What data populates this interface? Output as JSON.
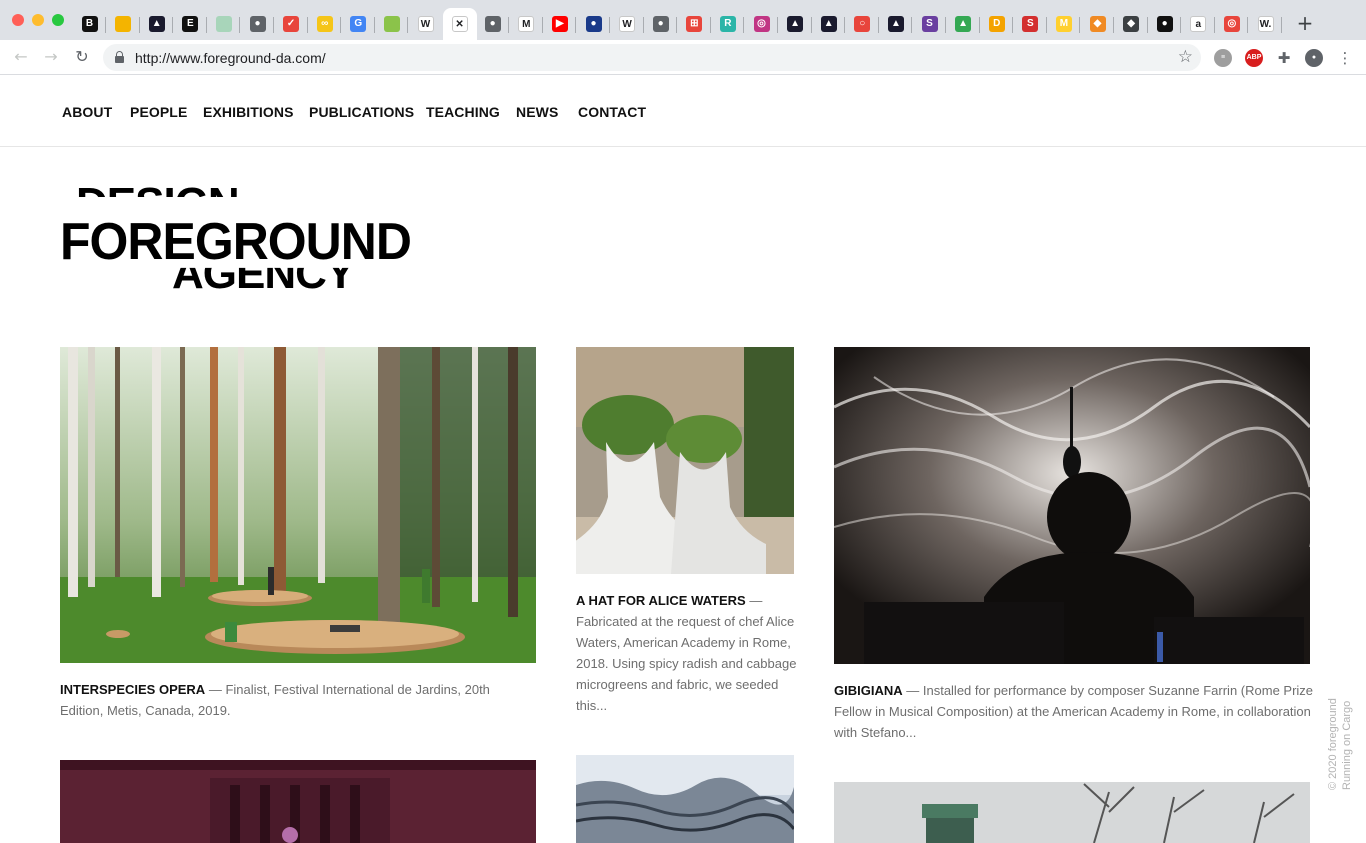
{
  "browser": {
    "url": "http://www.foreground-da.com/",
    "tab_favicons": [
      {
        "icon": "b-icon",
        "glyph": "B",
        "color": "#111111"
      },
      {
        "icon": "slides-icon",
        "glyph": "",
        "color": "#f4b400"
      },
      {
        "icon": "arch-icon",
        "glyph": "▲",
        "color": "#1a1a2e"
      },
      {
        "icon": "e-icon",
        "glyph": "E",
        "color": "#111111"
      },
      {
        "icon": "sheet-icon",
        "glyph": "",
        "color": "#a8d5ba"
      },
      {
        "icon": "globe-icon",
        "glyph": "●",
        "color": "#5f6368"
      },
      {
        "icon": "pocket-icon",
        "glyph": "✓",
        "color": "#e8453c"
      },
      {
        "icon": "link-icon",
        "glyph": "∞",
        "color": "#f5c518"
      },
      {
        "icon": "google-icon",
        "glyph": "G",
        "color": "#4285f4"
      },
      {
        "icon": "shield-icon",
        "glyph": "",
        "color": "#8bc34a"
      },
      {
        "icon": "wikipedia-icon",
        "glyph": "W",
        "color": "#ffffff"
      },
      {
        "icon": "close-icon",
        "glyph": "✕",
        "color": "#ffffff"
      },
      {
        "icon": "globe-icon",
        "glyph": "●",
        "color": "#5f6368"
      },
      {
        "icon": "m-icon",
        "glyph": "M",
        "color": "#ffffff"
      },
      {
        "icon": "youtube-icon",
        "glyph": "▶",
        "color": "#ff0000"
      },
      {
        "icon": "sphere-icon",
        "glyph": "●",
        "color": "#1a3a8a"
      },
      {
        "icon": "wikipedia-icon",
        "glyph": "W",
        "color": "#ffffff"
      },
      {
        "icon": "globe-icon",
        "glyph": "●",
        "color": "#5f6368"
      },
      {
        "icon": "grid-icon",
        "glyph": "⊞",
        "color": "#e8453c"
      },
      {
        "icon": "r-icon",
        "glyph": "R",
        "color": "#2bb5a8"
      },
      {
        "icon": "instagram-icon",
        "glyph": "◎",
        "color": "#c13584"
      },
      {
        "icon": "arch-icon",
        "glyph": "▲",
        "color": "#1a1a2e"
      },
      {
        "icon": "arch-icon",
        "glyph": "▲",
        "color": "#1a1a2e"
      },
      {
        "icon": "ring-icon",
        "glyph": "○",
        "color": "#e8453c"
      },
      {
        "icon": "arch-icon",
        "glyph": "▲",
        "color": "#1a1a2e"
      },
      {
        "icon": "s-icon",
        "glyph": "S",
        "color": "#6a3fa0"
      },
      {
        "icon": "drive-icon",
        "glyph": "▲",
        "color": "#34a853"
      },
      {
        "icon": "d-icon",
        "glyph": "D",
        "color": "#f4a300"
      },
      {
        "icon": "s-icon",
        "glyph": "S",
        "color": "#d32f2f"
      },
      {
        "icon": "miro-icon",
        "glyph": "M",
        "color": "#ffd02f"
      },
      {
        "icon": "cubes-icon",
        "glyph": "◆",
        "color": "#f08a24"
      },
      {
        "icon": "diamond-icon",
        "glyph": "◆",
        "color": "#3c4043"
      },
      {
        "icon": "black-circle-icon",
        "glyph": "●",
        "color": "#111111"
      },
      {
        "icon": "amazon-icon",
        "glyph": "a",
        "color": "#ffffff"
      },
      {
        "icon": "target-icon",
        "glyph": "◎",
        "color": "#e8453c"
      },
      {
        "icon": "w-icon",
        "glyph": "W.",
        "color": "#ffffff"
      }
    ],
    "extensions": [
      {
        "icon": "stack-icon",
        "glyph": "≡",
        "color": "#9e9e9e"
      },
      {
        "icon": "adblock-icon",
        "glyph": "ABP",
        "color": "#d81e1e"
      },
      {
        "icon": "puzzle-icon",
        "glyph": "✚",
        "color": "#5f6368"
      },
      {
        "icon": "profile-icon",
        "glyph": "●",
        "color": "#5f6368"
      },
      {
        "icon": "menu-dots-icon",
        "glyph": "⋮",
        "color": "#5f6368"
      }
    ]
  },
  "site": {
    "nav": [
      "ABOUT",
      "PEOPLE",
      "EXHIBITIONS",
      "PUBLICATIONS",
      "TEACHING",
      "NEWS",
      "CONTACT"
    ],
    "logo": {
      "line1": "DESIGN",
      "line2": "FOREGROUND",
      "line3": "AGENCY"
    },
    "projects": [
      {
        "title": "INTERSPECIES OPERA",
        "dash": " — ",
        "text": "Finalist, Festival International de Jardins, 20th Edition, Metis, Canada, 2019."
      },
      {
        "title": "A HAT FOR ALICE WATERS",
        "dash": " — ",
        "text": "Fabricated at the request of chef Alice Waters, American Academy in Rome, 2018. Using spicy radish and cabbage microgreens and fabric, we seeded this..."
      },
      {
        "title": "GIBIGIANA",
        "dash": " — ",
        "text": "Installed for performance by composer Suzanne Farrin (Rome Prize Fellow in Musical Composition) at the American Academy in Rome, in collaboration with Stefano..."
      }
    ],
    "footer": {
      "copyright": "© 2020 foreground",
      "credit": "Running on Cargo"
    }
  }
}
